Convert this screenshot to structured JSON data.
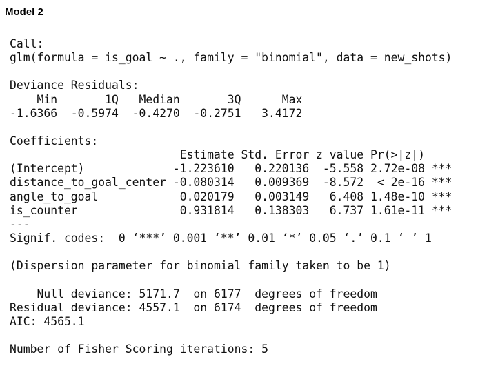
{
  "title": "Model 2",
  "call": {
    "header": "Call:",
    "formula": "glm(formula = is_goal ~ ., family = \"binomial\", data = new_shots)"
  },
  "deviance_residuals": {
    "header": "Deviance Residuals:",
    "labels_line": "    Min       1Q   Median       3Q      Max  ",
    "values_line": "-1.6366  -0.5974  -0.4270  -0.2751   3.4172  "
  },
  "coefficients": {
    "header": "Coefficients:",
    "column_header": "                         Estimate Std. Error z value Pr(>|z|)    ",
    "rows": [
      "(Intercept)             -1.223610   0.220136  -5.558 2.72e-08 ***",
      "distance_to_goal_center -0.080314   0.009369  -8.572  < 2e-16 ***",
      "angle_to_goal            0.020179   0.003149   6.408 1.48e-10 ***",
      "is_counter               0.931814   0.138303   6.737 1.61e-11 ***"
    ],
    "separator": "---",
    "signif_codes": "Signif. codes:  0 ‘***’ 0.001 ‘**’ 0.01 ‘*’ 0.05 ‘.’ 0.1 ‘ ’ 1"
  },
  "dispersion": "(Dispersion parameter for binomial family taken to be 1)",
  "deviance": {
    "null": "    Null deviance: 5171.7  on 6177  degrees of freedom",
    "residual": "Residual deviance: 4557.1  on 6174  degrees of freedom",
    "aic": "AIC: 4565.1"
  },
  "fisher": "Number of Fisher Scoring iterations: 5"
}
